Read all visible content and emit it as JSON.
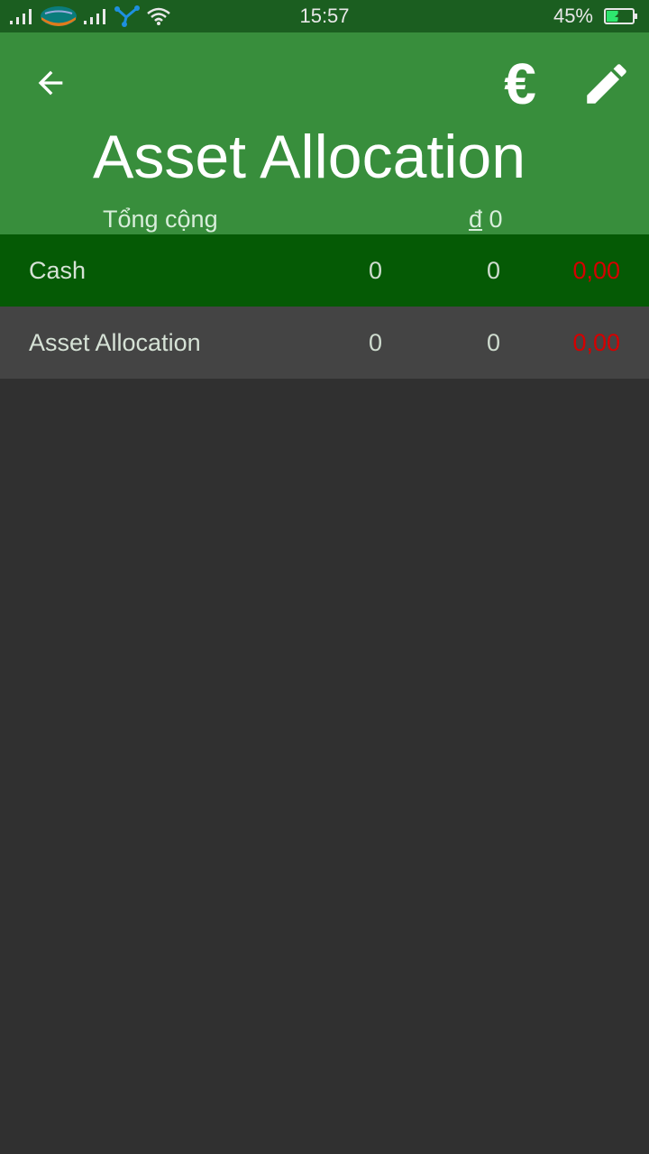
{
  "status_bar": {
    "time": "15:57",
    "battery_percent": "45%",
    "battery_level": 0.45,
    "icons": [
      "signal-icon",
      "carrier-logo-icon",
      "signal-icon",
      "app-notification-icon",
      "wifi-icon",
      "battery-charging-icon"
    ]
  },
  "app_bar": {
    "title": "Asset Allocation",
    "total_label": "Tổng cộng",
    "total_currency": "đ",
    "total_value": "0",
    "icons": {
      "back": "arrow-back-icon",
      "currency": "euro-icon",
      "edit": "pencil-icon"
    },
    "currency_symbol": "€"
  },
  "rows": [
    {
      "name": "Cash",
      "v1": "0",
      "v2": "0",
      "v3": "0,00"
    },
    {
      "name": "Asset Allocation",
      "v1": "0",
      "v2": "0",
      "v3": "0,00"
    }
  ],
  "colors": {
    "status_bar": "#1b5e20",
    "app_bar": "#388e3c",
    "selected_row": "#055a05",
    "row": "#444444",
    "background": "#303030",
    "negative_value": "#d50000"
  }
}
